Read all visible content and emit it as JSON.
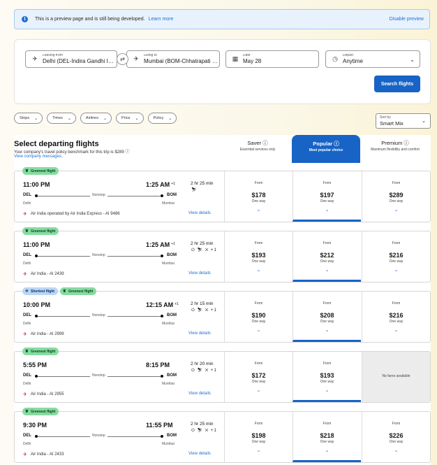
{
  "banner": {
    "message": "This is a preview page and is still being developed.",
    "learn_more": "Learn more",
    "disable": "Disable preview"
  },
  "search": {
    "from_label": "Leaving from",
    "from_value": "Delhi (DEL-Indira Gandhi Intl.)",
    "to_label": "Going to",
    "to_value": "Mumbai (BOM-Chhatrapati Shivaji Intl.)",
    "date_label": "Date",
    "date_value": "May 28",
    "depart_label": "Depart",
    "depart_value": "Anytime",
    "button": "Search flights"
  },
  "filters": [
    "Stops",
    "Times",
    "Airlines",
    "Price",
    "Policy"
  ],
  "sort": {
    "label": "Sort by",
    "value": "Smart Mix"
  },
  "results": {
    "title": "Select departing flights",
    "policy_text": "Your company's travel policy benchmark for this trip is $289",
    "messages_link": "View company messages."
  },
  "columns": [
    {
      "name": "Saver",
      "desc": "Essential services only"
    },
    {
      "name": "Popular",
      "desc": "Most popular choice"
    },
    {
      "name": "Premium",
      "desc": "Maximum flexibility and comfort"
    }
  ],
  "labels": {
    "from": "From",
    "one_way": "One way",
    "nonstop": "Nonstop",
    "view_details": "View details",
    "no_fares": "No fares available"
  },
  "flights": [
    {
      "tags": [
        {
          "text": "Greenest flight",
          "kind": "green"
        }
      ],
      "dep": "11:00 PM",
      "arr": "1:25 AM",
      "plus": "+1",
      "from_code": "DEL",
      "to_code": "BOM",
      "from_city": "Delhi",
      "to_city": "Mumbai",
      "duration": "2 hr 25 min",
      "amenities": "⛷",
      "airline": "Air India operated by Air India Express - AI 9486",
      "fares": [
        "$178",
        "$197",
        "$289"
      ]
    },
    {
      "tags": [
        {
          "text": "Greenest flight",
          "kind": "green"
        }
      ],
      "dep": "11:00 PM",
      "arr": "1:25 AM",
      "plus": "+1",
      "from_code": "DEL",
      "to_code": "BOM",
      "from_city": "Delhi",
      "to_city": "Mumbai",
      "duration": "2 hr 25 min",
      "amenities": "⏻ ⛷ ✕ +1",
      "airline": "Air India - AI 2439",
      "fares": [
        "$193",
        "$212",
        "$216"
      ]
    },
    {
      "tags": [
        {
          "text": "Shortest flight",
          "kind": "blue"
        },
        {
          "text": "Greenest flight",
          "kind": "green"
        }
      ],
      "dep": "10:00 PM",
      "arr": "12:15 AM",
      "plus": "+1",
      "from_code": "DEL",
      "to_code": "BOM",
      "from_city": "Delhi",
      "to_city": "Mumbai",
      "duration": "2 hr 15 min",
      "amenities": "⏻ ⛷ ✕ +1",
      "airline": "Air India - AI 2999",
      "fares": [
        "$190",
        "$208",
        "$216"
      ]
    },
    {
      "tags": [
        {
          "text": "Greenest flight",
          "kind": "green"
        }
      ],
      "dep": "5:55 PM",
      "arr": "8:15 PM",
      "plus": "",
      "from_code": "DEL",
      "to_code": "BOM",
      "from_city": "Delhi",
      "to_city": "Mumbai",
      "duration": "2 hr 20 min",
      "amenities": "⏻ ⛷ ✕ +1",
      "airline": "Air India - AI 2955",
      "fares": [
        "$172",
        "$193",
        null
      ]
    },
    {
      "tags": [
        {
          "text": "Greenest flight",
          "kind": "green"
        }
      ],
      "dep": "9:30 PM",
      "arr": "11:55 PM",
      "plus": "",
      "from_code": "DEL",
      "to_code": "BOM",
      "from_city": "Delhi",
      "to_city": "Mumbai",
      "duration": "2 hr 25 min",
      "amenities": "⏻ ⛷ ✕ +1",
      "airline": "Air India - AI 2433",
      "fares": [
        "$198",
        "$218",
        "$226"
      ]
    }
  ]
}
